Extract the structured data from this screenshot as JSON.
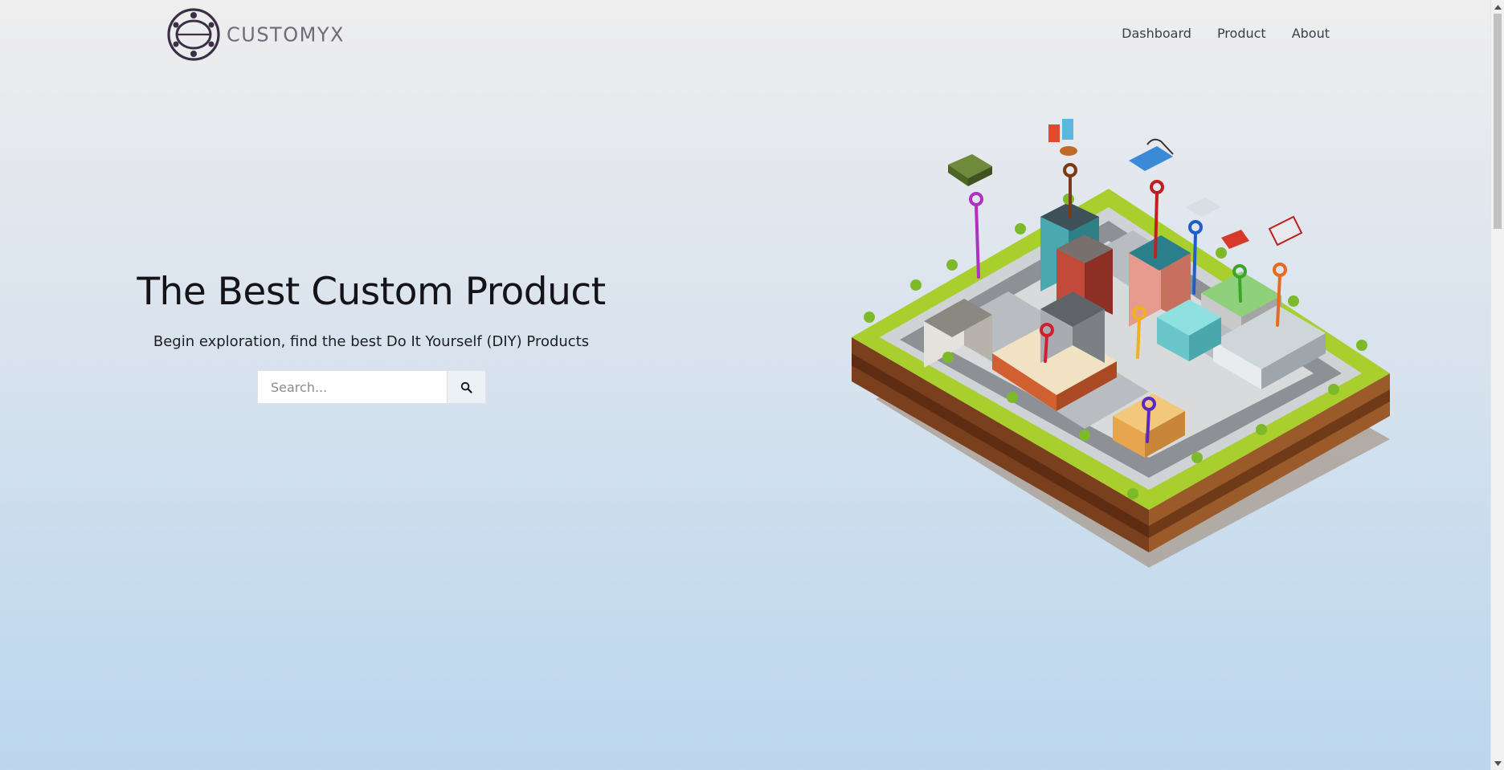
{
  "brand": {
    "name": "CUSTOMYX",
    "logo_icon": "orbit-logo-icon"
  },
  "nav": {
    "items": [
      "Dashboard",
      "Product",
      "About"
    ]
  },
  "hero": {
    "title": "The Best Custom Product",
    "subtitle": "Begin exploration, find the best Do It Yourself (DIY) Products",
    "illustration": "isometric-city-illustration"
  },
  "search": {
    "placeholder": "Search...",
    "value": "",
    "button_icon": "search-icon"
  },
  "colors": {
    "background_top": "#eeeeee",
    "background_bottom": "#bdd7ef",
    "logo": "#3a2f45",
    "text": "#141418"
  }
}
